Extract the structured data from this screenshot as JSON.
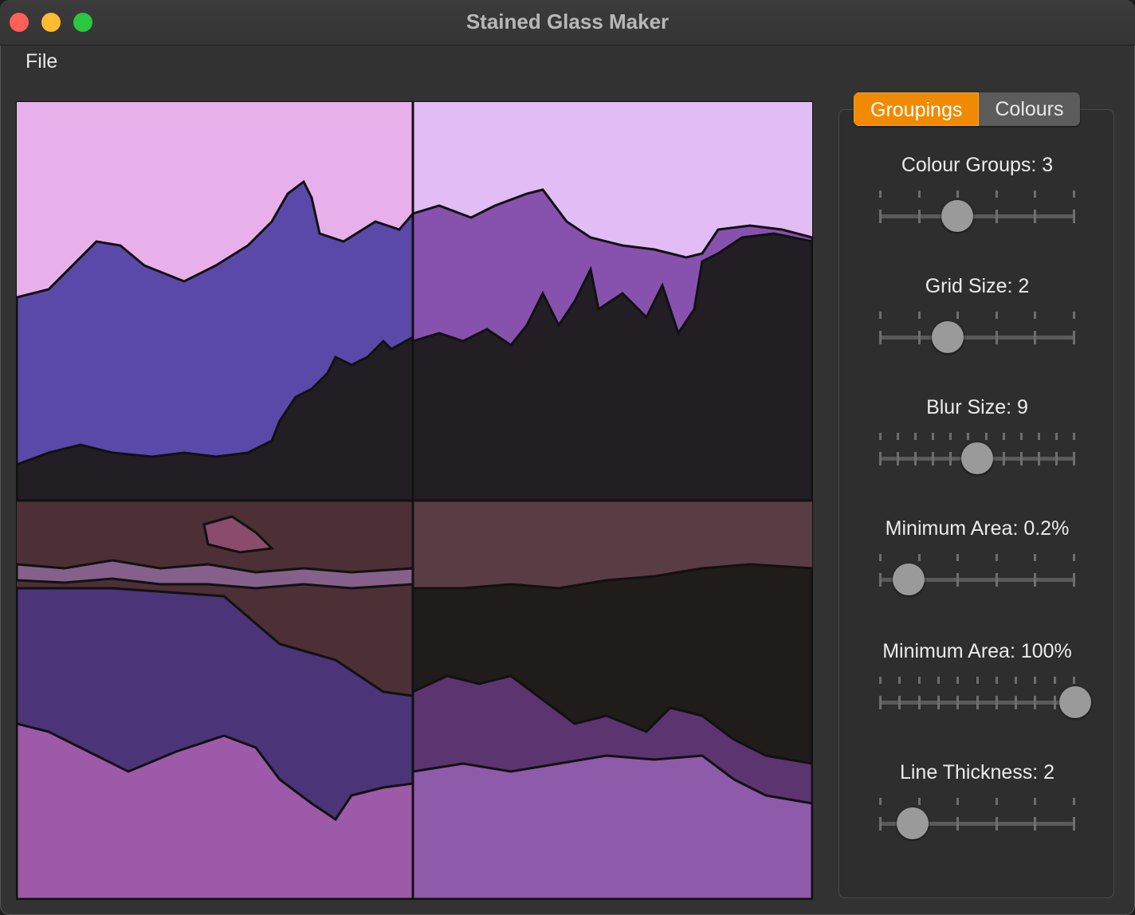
{
  "window": {
    "title": "Stained Glass Maker"
  },
  "menu": {
    "file": "File"
  },
  "tabs": [
    {
      "label": "Groupings",
      "active": true
    },
    {
      "label": "Colours",
      "active": false
    }
  ],
  "controls": [
    {
      "label": "Colour Groups: 3",
      "ticks": 6,
      "value_fraction": 0.4
    },
    {
      "label": "Grid Size: 2",
      "ticks": 6,
      "value_fraction": 0.35
    },
    {
      "label": "Blur Size: 9",
      "ticks": 12,
      "value_fraction": 0.5
    },
    {
      "label": "Minimum Area: 0.2%",
      "ticks": 6,
      "value_fraction": 0.15
    },
    {
      "label": "Minimum Area: 100%",
      "ticks": 11,
      "value_fraction": 1.0
    },
    {
      "label": "Line Thickness: 2",
      "ticks": 6,
      "value_fraction": 0.17
    }
  ],
  "colors": {
    "accent": "#f08a00",
    "sky_left": "#e8b0ea",
    "sky_right": "#e2bcf4",
    "mountain_left": "#5a49a8",
    "mountain_right": "#8652ae",
    "treeline": "#221e24",
    "water_brown": "#4c3036",
    "reflection_purple": "#4b3478",
    "lower_pink": "#9c5aa8",
    "lower_violet": "#8e5aaa"
  }
}
